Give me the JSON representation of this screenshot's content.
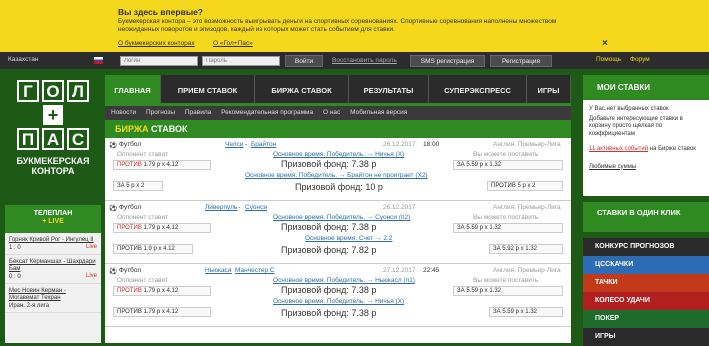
{
  "info_bar": {
    "title": "Вы здесь впервые?",
    "text": "Букмекерская контора – это возможность выигрывать деньги на спортивных соревнованиях. Спортивные соревнования наполнены множеством неожиданных поворотов и эпизодов, каждый из которых может стать событием для ставки.",
    "link1": "О букмекерских конторах",
    "link2": "О «Гол+Пас»",
    "close": "×"
  },
  "topbar": {
    "country": "Казахстан",
    "login_placeholder": "Логин",
    "password_placeholder": "Пароль",
    "login_button": "Войти",
    "restore_link": "Восстановить пароль",
    "sms_button": "SMS регистрация",
    "register_button": "Регистрация",
    "help": "Помощь",
    "forum": "Форум"
  },
  "logo": {
    "row1": [
      "Г",
      "О",
      "Л"
    ],
    "plus": "+",
    "row2": [
      "П",
      "А",
      "С"
    ],
    "subtitle": "БУКМЕКЕРСКАЯ КОНТОРА"
  },
  "teleplan": {
    "title": "ТЕЛЕПЛАН",
    "subtitle": "+ LIVE",
    "items": [
      {
        "match": "Горняк Кривой Рог - Ингулец II",
        "score": "1 : 0",
        "live": "Live"
      },
      {
        "match": "Бексат Керманшах - Шахрдари Бам",
        "score": "0 : 0",
        "live": "Live"
      },
      {
        "match": "Мес Новин Керман - Могавемат Техран",
        "score": "Иран. 2-я лига",
        "live": ""
      }
    ]
  },
  "main_tabs": [
    "ГЛАВНАЯ",
    "ПРИЕМ СТАВОК",
    "БИРЖА СТАВОК",
    "РЕЗУЛЬТАТЫ",
    "СУПЕРЭКСПРЕСС",
    "ИГРЫ"
  ],
  "sub_nav": [
    "Новости",
    "Прогнозы",
    "Правила",
    "Рекомендательная программа",
    "О нас",
    "Мобильная версия"
  ],
  "section": {
    "part1": "БИРЖА",
    "part2": "СТАВОК"
  },
  "events": [
    {
      "sport": "Футбол",
      "home": "Челси",
      "away": "Брайтон",
      "date": "26.12.2017",
      "time": "18:00",
      "league": "Англия. Премьер-Лига",
      "opp_label": "Оппонент ставит",
      "can_label": "Вы можете поставить",
      "outcome1": "Основное время. Победитель. → Ничья (X)",
      "fund1": "Призовой фонд: 7.38 р",
      "against": "ПРОТИВ",
      "against_val": "1.79 р х 4.12",
      "for": "ЗА",
      "for_val": "5.59 р х 1.32",
      "outcome2": "Основное время. Победитель. → Брайтон не проиграет (X2)",
      "fund2": "Призовой фонд: 10 р",
      "left2": "ЗА 5 р х 2",
      "right2": "ПРОТИВ 5 р х 2"
    },
    {
      "sport": "Футбол",
      "home": "Ливерпуль",
      "away": "Суонси",
      "date": "26.12.2017",
      "time": "",
      "league": "Англия. Премьер-Лига",
      "opp_label": "Оппонент ставит",
      "can_label": "Вы можете поставить",
      "outcome1": "Основное время. Победитель. → Суонси (п2)",
      "fund1": "Призовой фонд: 7.38 р",
      "against": "ПРОТИВ",
      "against_val": "1.79 р х 4.12",
      "for": "ЗА",
      "for_val": "5.59 р х 1.32",
      "outcome2": "Основное время. Счет → 2:2",
      "fund2": "Призовой фонд: 7.82 р",
      "left2": "ПРОТИВ 1.9 р х 4.12",
      "right2": "ЗА 5.92 р х 1.32"
    },
    {
      "sport": "Футбол",
      "home": "Ньюкасл",
      "away": "Манчестер С",
      "date": "27.12.2017",
      "time": "22:45",
      "league": "Англия. Премьер-Лига",
      "opp_label": "Оппонент ставит",
      "can_label": "Вы можете поставить",
      "outcome1": "Основное время. Победитель. → Ньюкасл (п1)",
      "fund1": "Призовой фонд: 7.38 р",
      "against": "ПРОТИВ",
      "against_val": "1.79 р х 4.12",
      "for": "ЗА",
      "for_val": "5.59 р х 1.32",
      "outcome2": "Основное время. Победитель. → Ничья (X)",
      "fund2": "Призовой фонд: 7.38 р",
      "left2": "ПРОТИВ 1.79 р х 4.12",
      "right2": "ЗА 5.59 р х 1.32"
    }
  ],
  "right": {
    "my_bets_title": "МОИ СТАВКИ",
    "no_bets": "У Вас нет выбранных ставок",
    "hint": "Добавьте интересующие ставки в корзину просто щелкая по коэффициентам",
    "active_link": "11 активных событий",
    "active_rest": "на Бирже ставок",
    "fav_link": "Любимые суммы",
    "one_click_title": "СТАВКИ В ОДИН КЛИК",
    "promos": [
      "КОНКУРС ПРОГНОЗОВ",
      "ЦССКАЧКИ",
      "ТАЧКИ",
      "КОЛЕСО УДАЧИ",
      "ПОКЕР",
      "ИГРЫ"
    ]
  },
  "colors": {
    "green": "#2f8a22",
    "yellow": "#f5d81c",
    "dark": "#2b2b2b"
  }
}
